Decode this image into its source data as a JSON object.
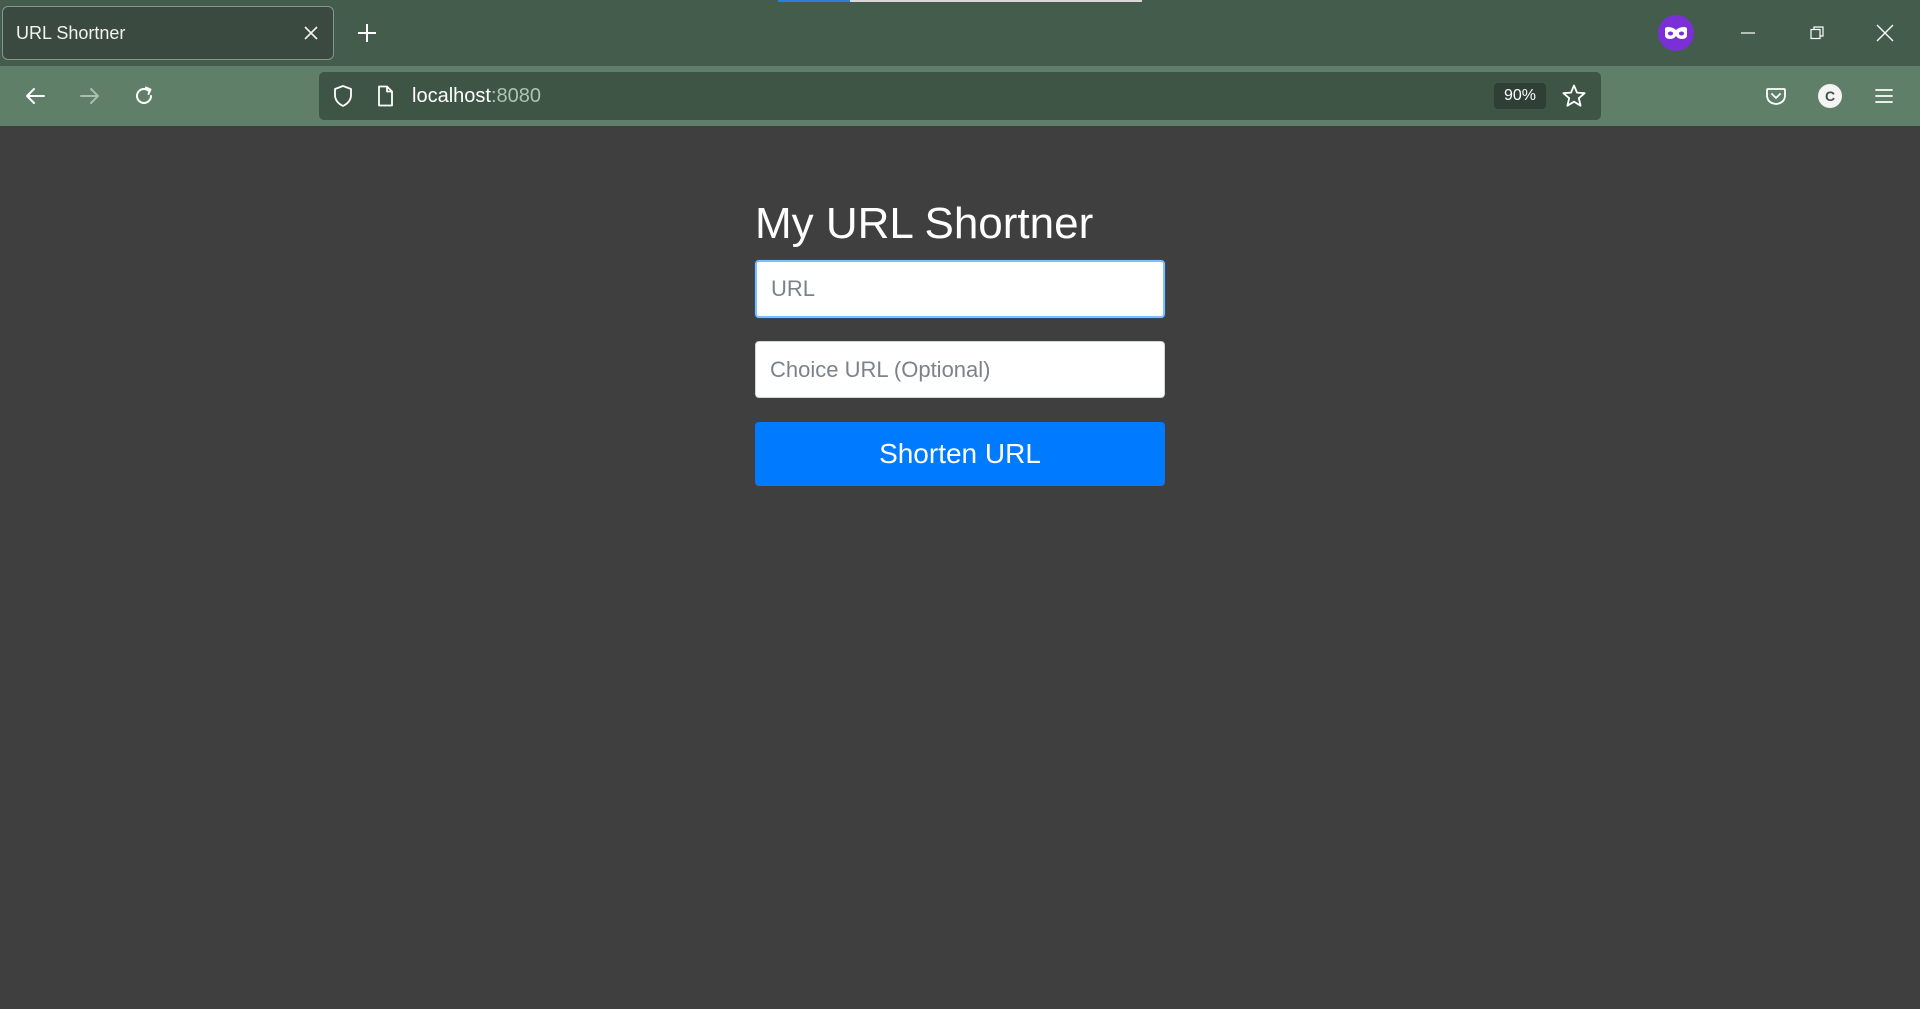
{
  "browser": {
    "tab": {
      "title": "URL Shortner"
    },
    "urlbar": {
      "host": "localhost",
      "port": ":8080",
      "zoom": "90%"
    },
    "account": {
      "initial": "C"
    }
  },
  "page": {
    "title": "My URL Shortner",
    "url_field": {
      "placeholder": "URL",
      "value": ""
    },
    "choice_field": {
      "placeholder": "Choice URL (Optional)",
      "value": ""
    },
    "submit_label": "Shorten URL"
  },
  "colors": {
    "tabbar": "#435c4c",
    "navbar": "#5f7f69",
    "page_background": "#3f3f3f",
    "primary_button": "#007bff",
    "private_badge": "#7b2fd6"
  },
  "icons": {
    "tab_close": "close-icon",
    "new_tab": "plus-icon",
    "private": "private-browsing-icon",
    "back": "arrow-left-icon",
    "forward": "arrow-right-icon",
    "reload": "reload-icon",
    "shield": "shield-icon",
    "page": "page-icon",
    "bookmark": "star-icon",
    "pocket": "pocket-icon",
    "menu": "hamburger-icon"
  }
}
